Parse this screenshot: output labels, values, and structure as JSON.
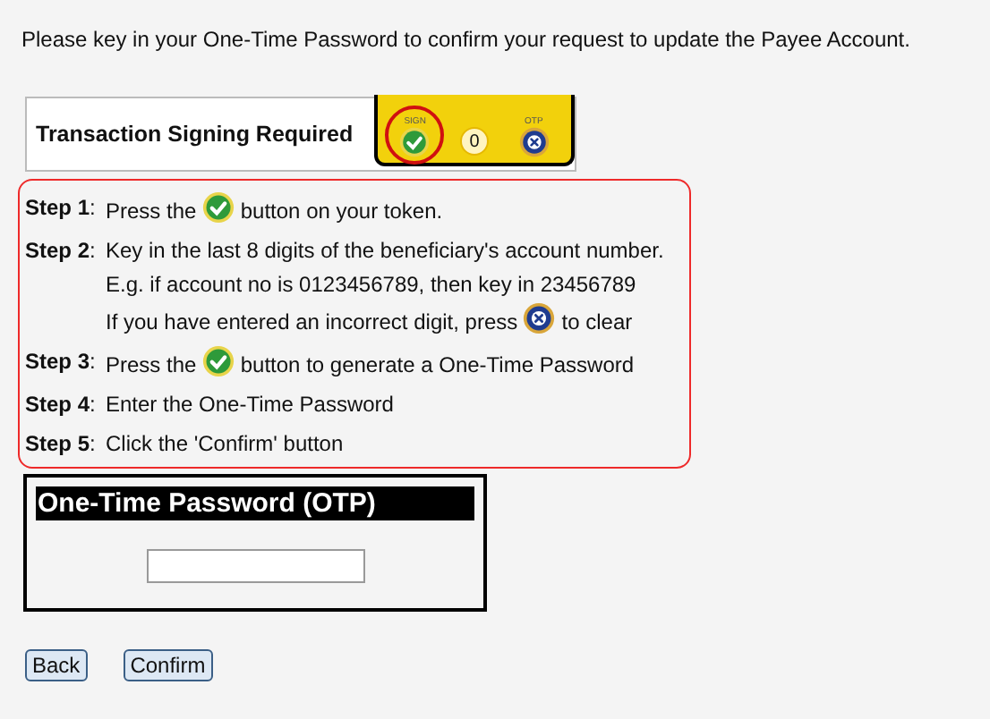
{
  "intro": "Please key in your One-Time Password to confirm your request to update the Payee Account.",
  "signing": {
    "label": "Transaction Signing Required",
    "token": {
      "sign_label": "SIGN",
      "display": "0",
      "otp_label": "OTP",
      "sign_highlighted": true
    }
  },
  "steps": [
    {
      "label": "**Step 1**:",
      "lines": [
        [
          {
            "kind": "text",
            "text": "Press the "
          },
          {
            "kind": "sign_button"
          },
          {
            "kind": "text",
            "text": " button on your token."
          }
        ]
      ]
    },
    {
      "label": "**Step 2**:",
      "lines": [
        [
          {
            "kind": "text",
            "text": "Key in the last 8 digits of the beneficiary's account number."
          }
        ],
        [
          {
            "kind": "text",
            "text": "E.g. if account no is 0123456789, then key in 23456789"
          }
        ],
        [
          {
            "kind": "text",
            "text": "If you have entered an incorrect digit, press "
          },
          {
            "kind": "clear_button"
          },
          {
            "kind": "text",
            "text": " to clear"
          }
        ]
      ]
    },
    {
      "label": "**Step 3**:",
      "lines": [
        [
          {
            "kind": "text",
            "text": "Press the "
          },
          {
            "kind": "sign_button"
          },
          {
            "kind": "text",
            "text": " button to generate a One-Time Password"
          }
        ]
      ]
    },
    {
      "label": "**Step 4**:",
      "lines": [
        [
          {
            "kind": "text",
            "text": "Enter the One-Time Password"
          }
        ]
      ]
    },
    {
      "label": "**Step 5**:",
      "lines": [
        [
          {
            "kind": "text",
            "text": "Click the 'Confirm' button"
          }
        ]
      ]
    }
  ],
  "otp": {
    "title": "One-Time Password (OTP)"
  },
  "buttons": [
    "Back",
    "Confirm"
  ]
}
